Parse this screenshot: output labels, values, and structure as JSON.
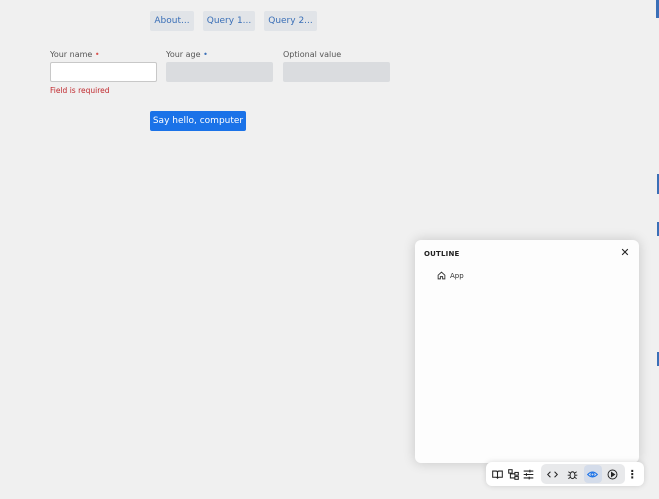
{
  "nav": {
    "about_label": "About...",
    "query1_label": "Query 1...",
    "query2_label": "Query 2..."
  },
  "form": {
    "name_label": "Your name",
    "age_label": "Your age",
    "optional_label": "Optional value",
    "required_marker": "•",
    "name_error": "Field is required",
    "submit_label": "Say hello, computer"
  },
  "outline": {
    "title": "OUTLINE",
    "close_glyph": "✕",
    "items": [
      {
        "label": "App",
        "icon": "home-icon"
      }
    ]
  },
  "toolbar": {
    "icons": [
      "book-icon",
      "component-tree-icon",
      "sliders-icon",
      "code-icon",
      "bug-icon",
      "eye-icon",
      "play-icon",
      "more-vertical-icon"
    ],
    "more_glyph": "⋮"
  },
  "colors": {
    "background": "#f0f0f0",
    "nav_button_bg": "#e1e4e8",
    "nav_button_text": "#3a6fb7",
    "primary": "#1a72e8",
    "error": "#c0282d"
  }
}
